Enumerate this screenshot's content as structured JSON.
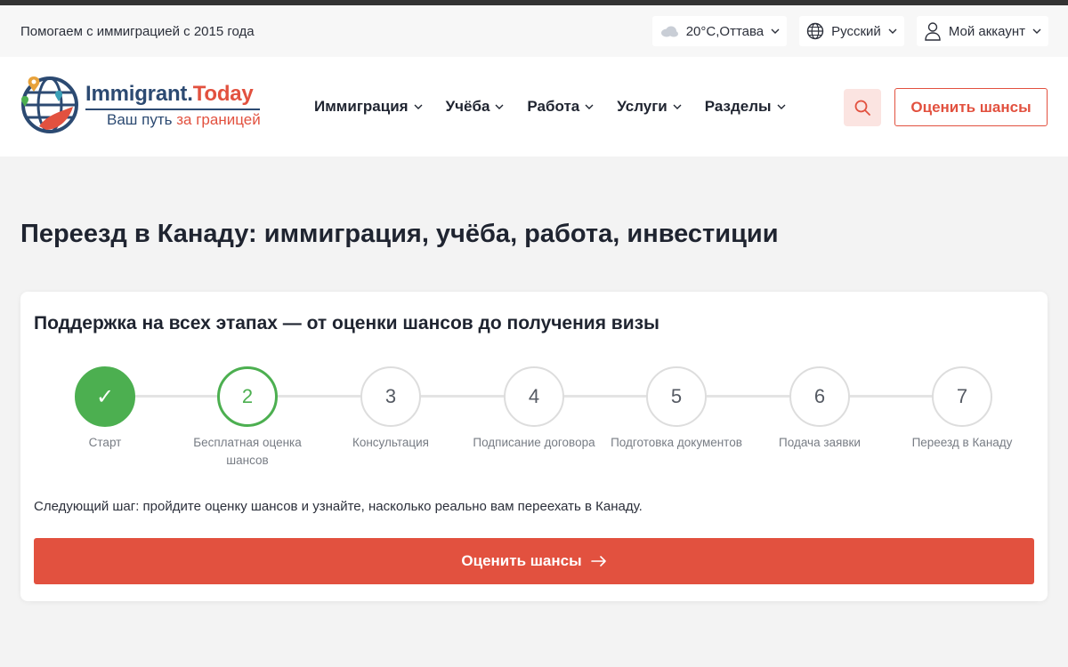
{
  "topbar": {
    "tagline": "Помогаем с иммиграцией с 2015 года",
    "weather": "20°C,Оттава",
    "language": "Русский",
    "account": "Мой аккаунт"
  },
  "header": {
    "logo": {
      "name_part1": "Immigrant.",
      "name_part2": "Today",
      "subtitle_part1": "Ваш путь ",
      "subtitle_part2": "за границей"
    },
    "nav": [
      {
        "label": "Иммиграция"
      },
      {
        "label": "Учёба"
      },
      {
        "label": "Работа"
      },
      {
        "label": "Услуги"
      },
      {
        "label": "Разделы"
      }
    ],
    "cta": "Оценить шансы"
  },
  "main": {
    "title": "Переезд в Канаду: иммиграция, учёба, работа, инвестиции",
    "card": {
      "title": "Поддержка на всех этапах — от оценки шансов до получения визы",
      "steps": [
        {
          "marker": "✓",
          "label": "Старт",
          "state": "done"
        },
        {
          "marker": "2",
          "label": "Бесплатная оценка шансов",
          "state": "current"
        },
        {
          "marker": "3",
          "label": "Консультация",
          "state": "pending"
        },
        {
          "marker": "4",
          "label": "Подписание договора",
          "state": "pending"
        },
        {
          "marker": "5",
          "label": "Подготовка документов",
          "state": "pending"
        },
        {
          "marker": "6",
          "label": "Подача заявки",
          "state": "pending"
        },
        {
          "marker": "7",
          "label": "Переезд в Канаду",
          "state": "pending"
        }
      ],
      "next_step": "Следующий шаг: пройдите оценку шансов и узнайте, насколько реально вам переехать в Канаду.",
      "cta": "Оценить шансы",
      "cta_icon": "arrow-right-icon"
    }
  },
  "colors": {
    "accent": "#e2513f",
    "brand": "#2c4a72",
    "success": "#4caf50"
  }
}
